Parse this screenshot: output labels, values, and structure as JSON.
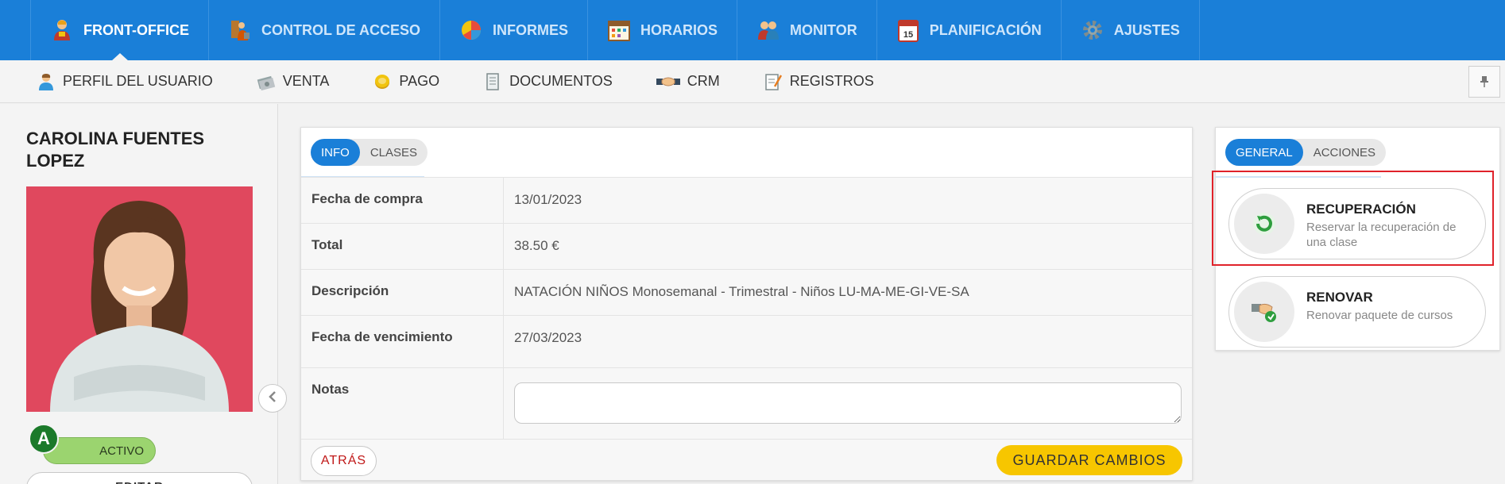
{
  "topnav": {
    "items": [
      {
        "label": "FRONT-OFFICE",
        "active": true,
        "icon": "user-desk-icon"
      },
      {
        "label": "CONTROL DE ACCESO",
        "active": false,
        "icon": "access-control-icon"
      },
      {
        "label": "INFORMES",
        "active": false,
        "icon": "pie-chart-icon"
      },
      {
        "label": "HORARIOS",
        "active": false,
        "icon": "calendar-grid-icon"
      },
      {
        "label": "MONITOR",
        "active": false,
        "icon": "users-group-icon"
      },
      {
        "label": "PLANIFICACIÓN",
        "active": false,
        "icon": "calendar-day-icon"
      },
      {
        "label": "AJUSTES",
        "active": false,
        "icon": "gear-icon"
      }
    ],
    "calendar_day": "15"
  },
  "subnav": {
    "items": [
      {
        "label": "PERFIL DEL USUARIO",
        "icon": "user-profile-icon"
      },
      {
        "label": "VENTA",
        "icon": "cash-icon"
      },
      {
        "label": "PAGO",
        "icon": "coin-icon"
      },
      {
        "label": "DOCUMENTOS",
        "icon": "document-icon"
      },
      {
        "label": "CRM",
        "icon": "handshake-icon"
      },
      {
        "label": "REGISTROS",
        "icon": "notes-icon"
      }
    ],
    "pin_icon": "pin-icon"
  },
  "user": {
    "name": "CAROLINA FUENTES LOPEZ",
    "badge_letter": "A",
    "status": "ACTIVO",
    "edit_label": "EDITAR"
  },
  "info_panel": {
    "tabs": [
      {
        "label": "INFO",
        "active": true
      },
      {
        "label": "CLASES",
        "active": false
      }
    ],
    "rows": [
      {
        "label": "Fecha de compra",
        "value": "13/01/2023"
      },
      {
        "label": "Total",
        "value": "38.50 €"
      },
      {
        "label": "Descripción",
        "value": "NATACIÓN NIÑOS Monosemanal - Trimestral - Niños LU-MA-ME-GI-VE-SA"
      },
      {
        "label": "Fecha de vencimiento",
        "value": "27/03/2023"
      }
    ],
    "notes_label": "Notas",
    "notes_value": "",
    "back_label": "ATRÁS",
    "save_label": "GUARDAR CAMBIOS"
  },
  "actions_panel": {
    "tabs": [
      {
        "label": "GENERAL",
        "active": true
      },
      {
        "label": "ACCIONES",
        "active": false
      }
    ],
    "actions": [
      {
        "title": "RECUPERACIÓN",
        "description": "Reservar la recuperación de una clase",
        "icon": "recovery-arrow-icon",
        "highlighted": true
      },
      {
        "title": "RENOVAR",
        "description": "Renovar paquete de cursos",
        "icon": "renew-hand-icon",
        "highlighted": false
      }
    ]
  },
  "colors": {
    "primary_blue": "#1a7fd8",
    "status_green": "#9bd46f",
    "badge_green": "#1b7a2a",
    "save_yellow": "#f7c600",
    "back_red": "#c01818",
    "highlight_red": "#e0222a",
    "photo_background": "#e0485e"
  }
}
